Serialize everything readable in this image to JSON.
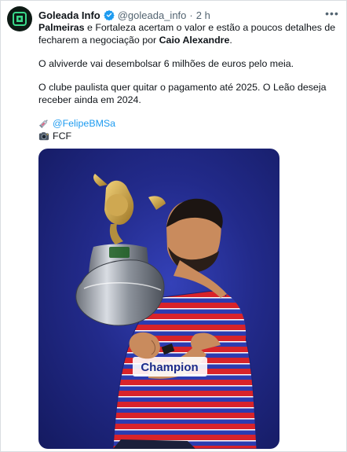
{
  "tweet": {
    "author_name": "Goleada Info",
    "handle": "@goleada_info",
    "separator": "·",
    "time": "2 h",
    "more_label": "•••",
    "p1": {
      "bold1": "Palmeiras",
      "text1": " e Fortaleza acertam o valor e estão a poucos detalhes de fecharem a negociação por ",
      "bold2": "Caio Alexandre",
      "text2": "."
    },
    "p2": "O alviverde vai desembolsar 6 milhões de euros pelo meia.",
    "p3": "O clube paulista quer quitar o pagamento até 2025. O Leão deseja receber ainda em 2024.",
    "credit_link": "@FelipeBMSa",
    "credit_photo": "FCF",
    "icons": {
      "verified": "verified-badge-icon",
      "syringe": "syringe-emoji-icon",
      "camera": "camera-emoji-icon"
    },
    "colors": {
      "link": "#1d9bf0",
      "secondary_text": "#536471",
      "media_background": "#222a8a"
    }
  }
}
